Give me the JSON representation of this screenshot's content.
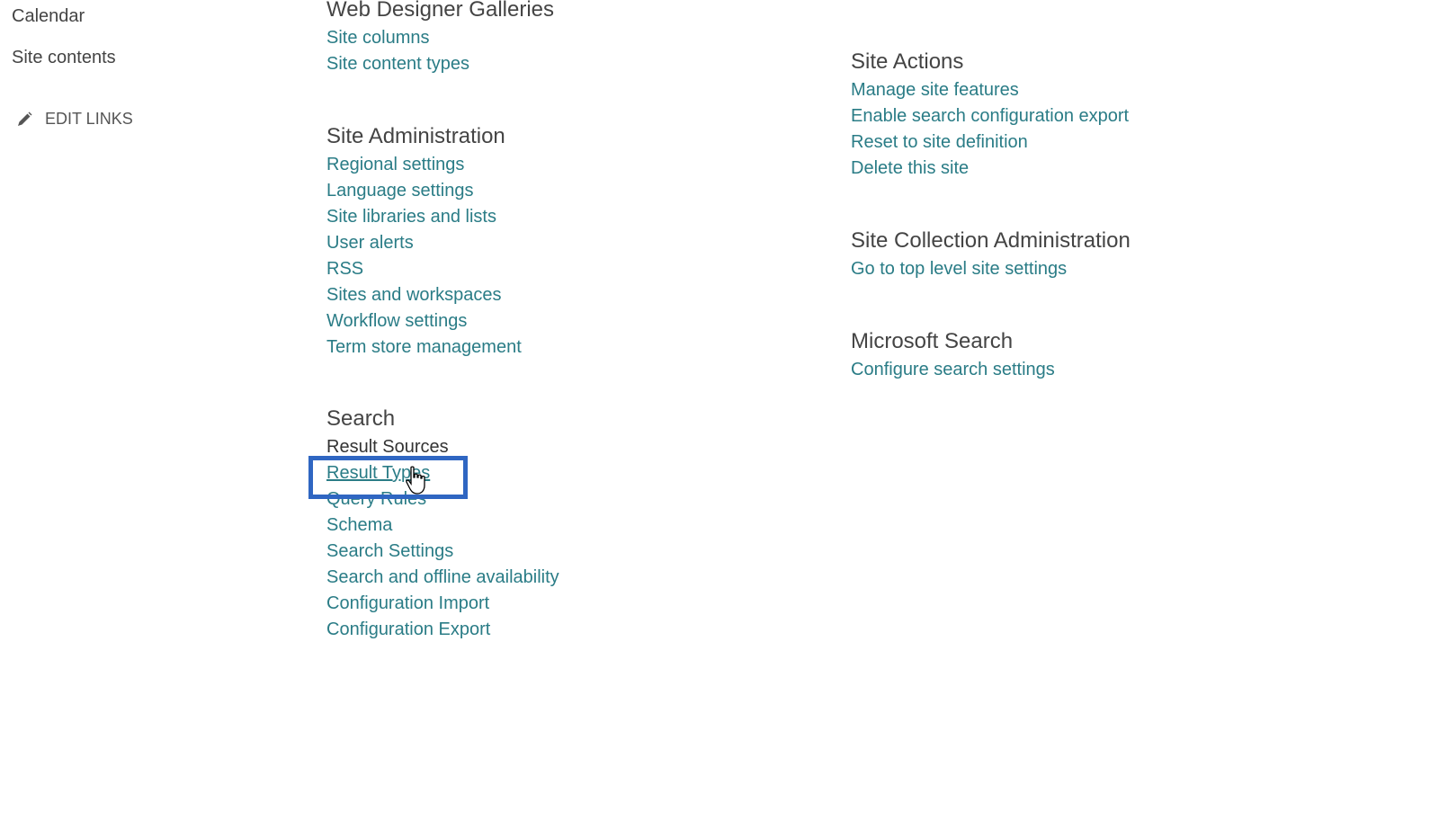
{
  "left_nav": {
    "items": [
      {
        "label": "Calendar"
      },
      {
        "label": "Site contents"
      }
    ],
    "edit_links_label": "EDIT LINKS"
  },
  "sections": {
    "web_designer_galleries": {
      "heading": "Web Designer Galleries",
      "links": [
        "Site columns",
        "Site content types"
      ]
    },
    "site_administration": {
      "heading": "Site Administration",
      "links": [
        "Regional settings",
        "Language settings",
        "Site libraries and lists",
        "User alerts",
        "RSS",
        "Sites and workspaces",
        "Workflow settings",
        "Term store management"
      ]
    },
    "search": {
      "heading": "Search",
      "links": [
        "Result Sources",
        "Result Types",
        "Query Rules",
        "Schema",
        "Search Settings",
        "Search and offline availability",
        "Configuration Import",
        "Configuration Export"
      ]
    },
    "site_actions": {
      "heading": "Site Actions",
      "links": [
        "Manage site features",
        "Enable search configuration export",
        "Reset to site definition",
        "Delete this site"
      ]
    },
    "site_collection_administration": {
      "heading": "Site Collection Administration",
      "links": [
        "Go to top level site settings"
      ]
    },
    "microsoft_search": {
      "heading": "Microsoft Search",
      "links": [
        "Configure search settings"
      ]
    }
  },
  "colors": {
    "link": "#2a7c86",
    "heading": "#444444",
    "highlight": "#2f66c2"
  },
  "highlighted_link": "Result Types"
}
